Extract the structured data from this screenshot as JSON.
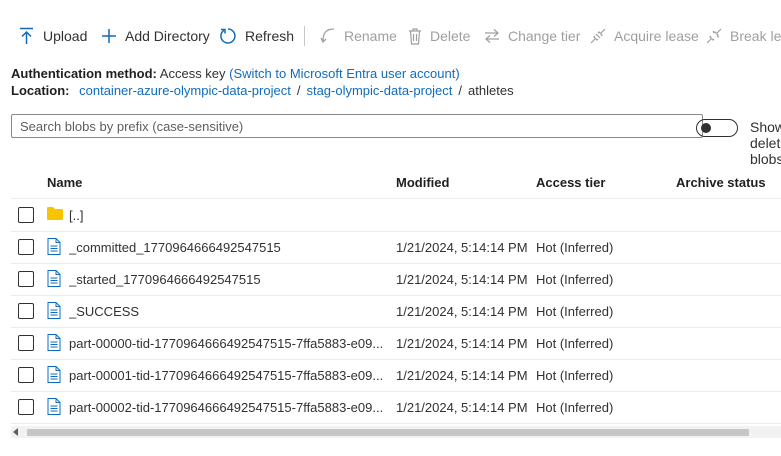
{
  "toolbar": {
    "upload": "Upload",
    "add_directory": "Add Directory",
    "refresh": "Refresh",
    "rename": "Rename",
    "delete": "Delete",
    "change_tier": "Change tier",
    "acquire_lease": "Acquire lease",
    "break_lease": "Break lease"
  },
  "auth": {
    "label": "Authentication method:",
    "value": "Access key",
    "switch_link": "(Switch to Microsoft Entra user account)"
  },
  "location": {
    "label": "Location:",
    "crumbs": [
      "container-azure-olympic-data-project",
      "stag-olympic-data-project",
      "athletes"
    ]
  },
  "search": {
    "placeholder": "Search blobs by prefix (case-sensitive)"
  },
  "toggle": {
    "label": "Show deleted blobs",
    "on": false
  },
  "table": {
    "columns": [
      "Name",
      "Modified",
      "Access tier",
      "Archive status"
    ],
    "rows": [
      {
        "icon": "folder-icon",
        "name": "[..]",
        "modified": "",
        "tier": ""
      },
      {
        "icon": "file-icon",
        "name": "_committed_1770964666492547515",
        "modified": "1/21/2024, 5:14:14 PM",
        "tier": "Hot (Inferred)"
      },
      {
        "icon": "file-icon",
        "name": "_started_1770964666492547515",
        "modified": "1/21/2024, 5:14:14 PM",
        "tier": "Hot (Inferred)"
      },
      {
        "icon": "file-icon",
        "name": "_SUCCESS",
        "modified": "1/21/2024, 5:14:14 PM",
        "tier": "Hot (Inferred)"
      },
      {
        "icon": "file-icon",
        "name": "part-00000-tid-1770964666492547515-7ffa5883-e09...",
        "modified": "1/21/2024, 5:14:14 PM",
        "tier": "Hot (Inferred)"
      },
      {
        "icon": "file-icon",
        "name": "part-00001-tid-1770964666492547515-7ffa5883-e09...",
        "modified": "1/21/2024, 5:14:14 PM",
        "tier": "Hot (Inferred)"
      },
      {
        "icon": "file-icon",
        "name": "part-00002-tid-1770964666492547515-7ffa5883-e09...",
        "modified": "1/21/2024, 5:14:14 PM",
        "tier": "Hot (Inferred)"
      }
    ]
  },
  "colors": {
    "accent": "#0f6cbd",
    "folder": "#f7c400",
    "disabled": "#a19f9d"
  }
}
